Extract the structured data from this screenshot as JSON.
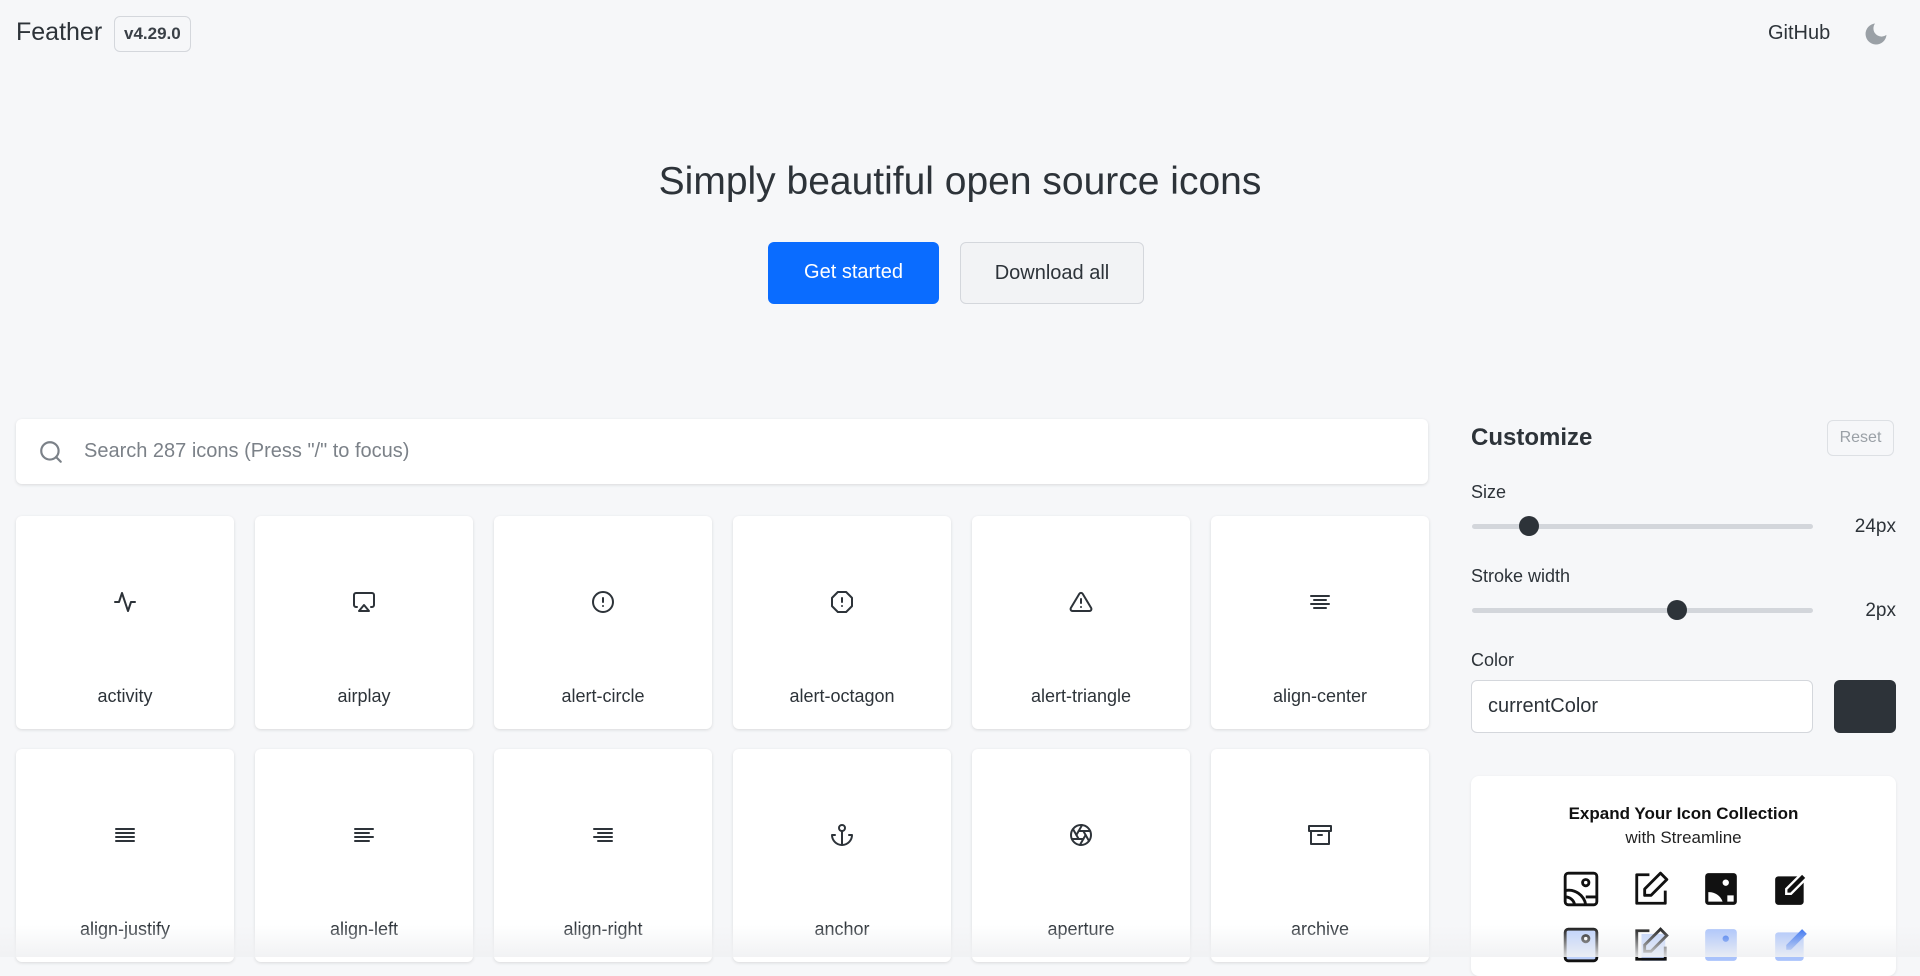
{
  "header": {
    "brand": "Feather",
    "version": "v4.29.0",
    "github": "GitHub",
    "theme_icon": "moon-icon"
  },
  "hero": {
    "title": "Simply beautiful open source icons",
    "get_started": "Get started",
    "download_all": "Download all"
  },
  "search": {
    "placeholder": "Search 287 icons (Press \"/\" to focus)",
    "value": ""
  },
  "icons": [
    "activity",
    "airplay",
    "alert-circle",
    "alert-octagon",
    "alert-triangle",
    "align-center",
    "align-justify",
    "align-left",
    "align-right",
    "anchor",
    "aperture",
    "archive"
  ],
  "customize": {
    "title": "Customize",
    "reset": "Reset",
    "size_label": "Size",
    "size_value": "24px",
    "size": 24,
    "size_range": [
      12,
      100
    ],
    "stroke_label": "Stroke width",
    "stroke_value": "2px",
    "stroke": 2,
    "stroke_range": [
      0.5,
      3
    ],
    "color_label": "Color",
    "color_value": "currentColor",
    "swatch": "#2d3339"
  },
  "promo": {
    "title": "Expand Your Icon Collection",
    "subtitle": "with Streamline"
  },
  "colors": {
    "accent": "#0a6cff",
    "text": "#2d3339"
  }
}
